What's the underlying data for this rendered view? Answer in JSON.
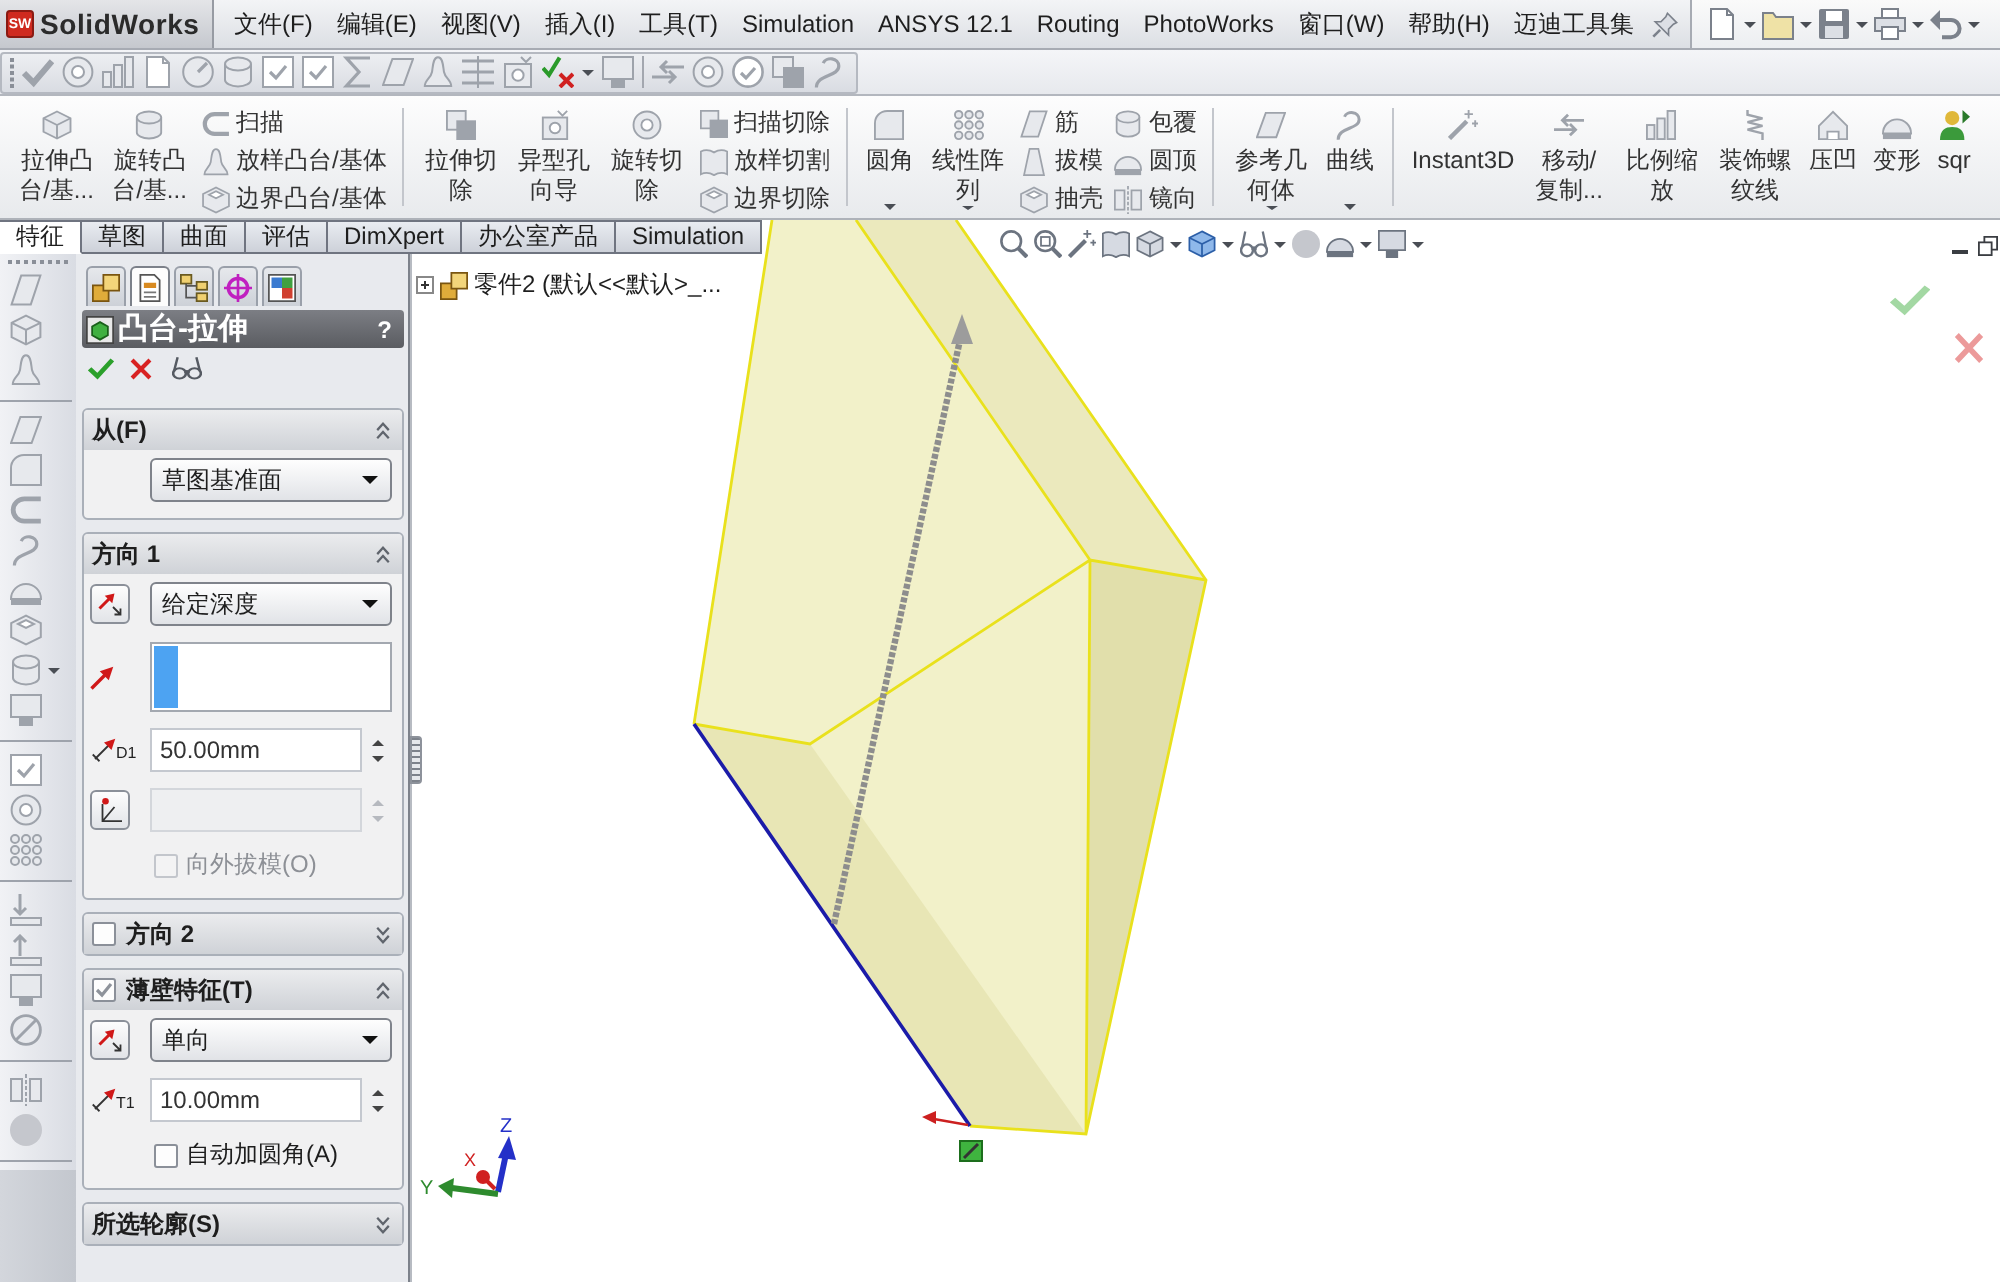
{
  "menu_bar": {
    "logo": {
      "badge": "SW",
      "text": "SolidWorks"
    },
    "items": [
      "文件(F)",
      "编辑(E)",
      "视图(V)",
      "插入(I)",
      "工具(T)",
      "Simulation",
      "ANSYS 12.1",
      "Routing",
      "PhotoWorks",
      "窗口(W)",
      "帮助(H)",
      "迈迪工具集"
    ]
  },
  "command_manager": {
    "groups": [
      {
        "items": [
          {
            "kind": "large",
            "label": "拉伸凸台/基...",
            "dropdown": false
          },
          {
            "kind": "large",
            "label": "旋转凸台/基...",
            "dropdown": false
          },
          {
            "kind": "stack",
            "entries": [
              "扫描",
              "放样凸台/基体",
              "边界凸台/基体"
            ]
          }
        ]
      },
      {
        "items": [
          {
            "kind": "large",
            "label": "拉伸切除",
            "dropdown": false
          },
          {
            "kind": "large",
            "label": "异型孔向导",
            "dropdown": false
          },
          {
            "kind": "large",
            "label": "旋转切除",
            "dropdown": false
          },
          {
            "kind": "stack",
            "entries": [
              "扫描切除",
              "放样切割",
              "边界切除"
            ]
          }
        ]
      },
      {
        "items": [
          {
            "kind": "large",
            "label": "圆角",
            "dropdown": true
          },
          {
            "kind": "large",
            "label": "线性阵列",
            "dropdown": true
          },
          {
            "kind": "stack",
            "entries": [
              "筋",
              "拔模",
              "抽壳"
            ]
          },
          {
            "kind": "stack",
            "entries": [
              "包覆",
              "圆顶",
              "镜向"
            ]
          }
        ]
      },
      {
        "items": [
          {
            "kind": "large",
            "label": "参考几何体",
            "dropdown": true
          },
          {
            "kind": "large",
            "label": "曲线",
            "dropdown": true
          }
        ]
      },
      {
        "items": [
          {
            "kind": "large",
            "label": "Instant3D",
            "dropdown": false
          },
          {
            "kind": "large",
            "label": "移动/复制...",
            "dropdown": false
          },
          {
            "kind": "large",
            "label": "比例缩放",
            "dropdown": false
          },
          {
            "kind": "large",
            "label": "装饰螺纹线",
            "dropdown": false
          },
          {
            "kind": "large",
            "label": "压凹",
            "dropdown": false
          },
          {
            "kind": "large",
            "label": "变形",
            "dropdown": false
          },
          {
            "kind": "large",
            "label": "sqr",
            "dropdown": false
          }
        ]
      }
    ],
    "tabs": [
      {
        "label": "特征",
        "selected": true
      },
      {
        "label": "草图",
        "selected": false
      },
      {
        "label": "曲面",
        "selected": false
      },
      {
        "label": "评估",
        "selected": false
      },
      {
        "label": "DimXpert",
        "selected": false
      },
      {
        "label": "办公室产品",
        "selected": false
      },
      {
        "label": "Simulation",
        "selected": false
      }
    ]
  },
  "property_manager": {
    "tabs": [
      {
        "selected": false
      },
      {
        "selected": true
      },
      {
        "selected": false
      },
      {
        "selected": false
      },
      {
        "selected": false
      }
    ],
    "title": "凸台-拉伸",
    "help": "?",
    "groups": [
      {
        "kind": "plain",
        "title": "从(F)",
        "expanded": true,
        "controls": [
          {
            "kind": "select",
            "value": "草图基准面"
          }
        ]
      },
      {
        "kind": "plain",
        "title": "方向 1",
        "expanded": true,
        "controls": [
          {
            "kind": "direction-select",
            "value": "给定深度"
          },
          {
            "kind": "selection-list",
            "active": true
          },
          {
            "kind": "spin",
            "tag": "D1",
            "value": "50.00mm",
            "disabled": false
          },
          {
            "kind": "draft-spin",
            "disabled": true
          },
          {
            "kind": "checkbox",
            "label": "向外拔模(O)",
            "checked": false,
            "disabled": true
          }
        ]
      },
      {
        "kind": "toggle",
        "title": "方向 2",
        "checked": false,
        "expanded": false
      },
      {
        "kind": "toggle",
        "title": "薄壁特征(T)",
        "checked": true,
        "expanded": true,
        "controls": [
          {
            "kind": "direction-select",
            "value": "单向"
          },
          {
            "kind": "spin",
            "tag": "T1",
            "value": "10.00mm",
            "disabled": false
          },
          {
            "kind": "checkbox",
            "label": "自动加圆角(A)",
            "checked": false,
            "disabled": false
          }
        ]
      },
      {
        "kind": "plain",
        "title": "所选轮廓(S)",
        "expanded": false
      }
    ]
  },
  "viewport": {
    "tree": {
      "items": [
        {
          "label": "零件2 (默认<<默认>_...",
          "expanded": false
        }
      ]
    },
    "triad": {
      "axes": [
        {
          "label": "Z",
          "color": "#2430c8"
        },
        {
          "label": "Y",
          "color": "#2e8b2e"
        },
        {
          "label": "X",
          "color": "#d02020"
        }
      ]
    }
  }
}
